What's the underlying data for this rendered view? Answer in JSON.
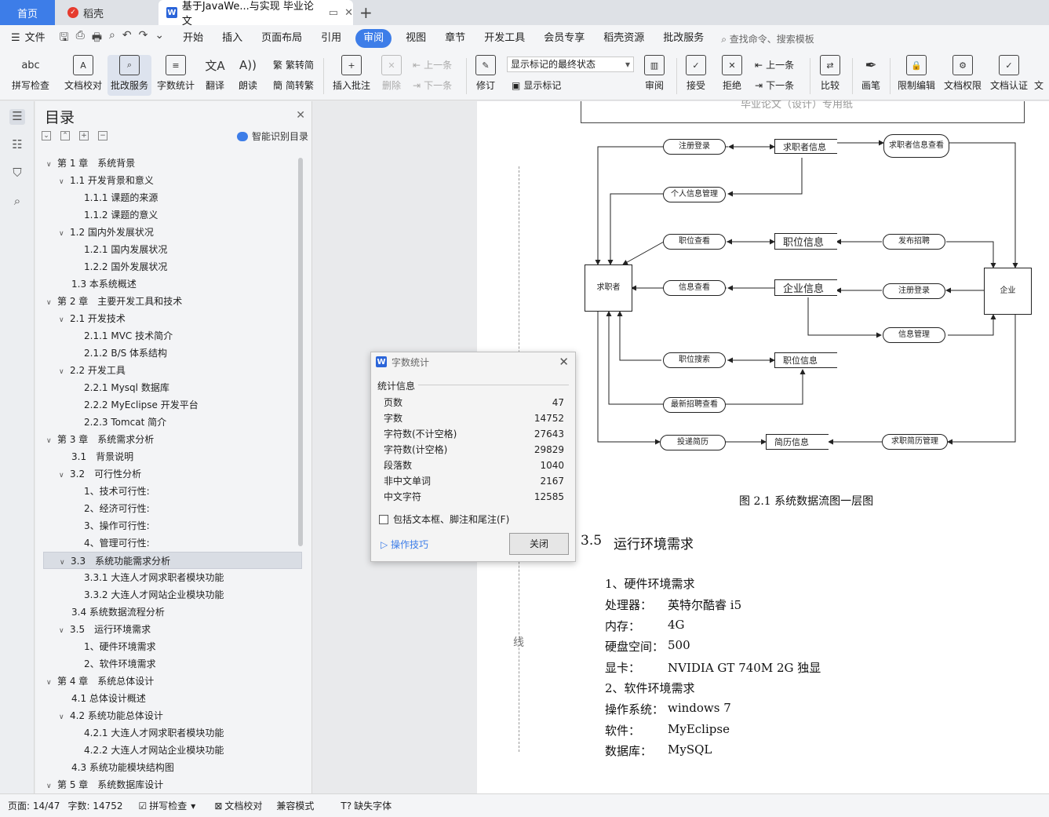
{
  "tabs": {
    "home": "首页",
    "daoke": "稻壳",
    "doc": "基于JavaWe...与实现 毕业论文"
  },
  "menu": {
    "file": "文件",
    "items": [
      "开始",
      "插入",
      "页面布局",
      "引用",
      "审阅",
      "视图",
      "章节",
      "开发工具",
      "会员专享",
      "稻壳资源",
      "批改服务"
    ],
    "active": "审阅",
    "search": "查找命令、搜索模板"
  },
  "ribbon": {
    "spell": "拼写检查",
    "doc_check": "文档校对",
    "correct": "批改服务",
    "word_count": "字数统计",
    "translate": "翻译",
    "read": "朗读",
    "to_trad": "繁转简",
    "to_simp": "简转繁",
    "insert_comment": "插入批注",
    "delete": "删除",
    "prev": "上一条",
    "next": "下一条",
    "revise": "修订",
    "markup_state": "显示标记的最终状态",
    "show_markup": "显示标记",
    "review": "审阅",
    "accept": "接受",
    "reject": "拒绝",
    "prev2": "上一条",
    "next2": "下一条",
    "compare": "比较",
    "pen": "画笔",
    "restrict": "限制编辑",
    "perm": "文档权限",
    "auth": "文档认证",
    "more": "文"
  },
  "toc": {
    "title": "目录",
    "smart": "智能识别目录",
    "items": [
      {
        "t": "第 1 章　系统背景",
        "lvl": 0,
        "c": true
      },
      {
        "t": "1.1 开发背景和意义",
        "lvl": 1,
        "c": true
      },
      {
        "t": "1.1.1  课题的来源",
        "lvl": 2,
        "c": false
      },
      {
        "t": "1.1.2 课题的意义",
        "lvl": 2,
        "c": false
      },
      {
        "t": "1.2  国内外发展状况",
        "lvl": 1,
        "c": true
      },
      {
        "t": "1.2.1  国内发展状况",
        "lvl": 2,
        "c": false
      },
      {
        "t": "1.2.2  国外发展状况",
        "lvl": 2,
        "c": false
      },
      {
        "t": "1.3 本系统概述",
        "lvl": 1,
        "c": false
      },
      {
        "t": "第 2 章　主要开发工具和技术",
        "lvl": 0,
        "c": true
      },
      {
        "t": "2.1  开发技术",
        "lvl": 1,
        "c": true
      },
      {
        "t": "2.1.1 MVC 技术简介",
        "lvl": 2,
        "c": false
      },
      {
        "t": "2.1.2 B/S 体系结构",
        "lvl": 2,
        "c": false
      },
      {
        "t": "2.2  开发工具",
        "lvl": 1,
        "c": true
      },
      {
        "t": "2.2.1 Mysql 数据库",
        "lvl": 2,
        "c": false
      },
      {
        "t": "2.2.2 MyEclipse 开发平台",
        "lvl": 2,
        "c": false
      },
      {
        "t": "2.2.3 Tomcat  简介",
        "lvl": 2,
        "c": false
      },
      {
        "t": "第 3 章　系统需求分析",
        "lvl": 0,
        "c": true
      },
      {
        "t": "3.1　背景说明",
        "lvl": 1,
        "c": false
      },
      {
        "t": "3.2　可行性分析",
        "lvl": 1,
        "c": true
      },
      {
        "t": "1、技术可行性:",
        "lvl": 2,
        "c": false
      },
      {
        "t": "2、经济可行性:",
        "lvl": 2,
        "c": false
      },
      {
        "t": "3、操作可行性:",
        "lvl": 2,
        "c": false
      },
      {
        "t": "4、管理可行性:",
        "lvl": 2,
        "c": false
      },
      {
        "t": "3.3　系统功能需求分析",
        "lvl": 1,
        "c": true,
        "sel": true
      },
      {
        "t": "3.3.1 大连人才网求职者模块功能",
        "lvl": 2,
        "c": false
      },
      {
        "t": "3.3.2 大连人才网站企业模块功能",
        "lvl": 2,
        "c": false
      },
      {
        "t": "3.4 系统数据流程分析",
        "lvl": 1,
        "c": false
      },
      {
        "t": "3.5　运行环境需求",
        "lvl": 1,
        "c": true
      },
      {
        "t": "1、硬件环境需求",
        "lvl": 2,
        "c": false
      },
      {
        "t": "2、软件环境需求",
        "lvl": 2,
        "c": false
      },
      {
        "t": "第 4 章　系统总体设计",
        "lvl": 0,
        "c": true
      },
      {
        "t": "4.1 总体设计概述",
        "lvl": 1,
        "c": false
      },
      {
        "t": "4.2 系统功能总体设计",
        "lvl": 1,
        "c": true
      },
      {
        "t": "4.2.1 大连人才网求职者模块功能",
        "lvl": 2,
        "c": false
      },
      {
        "t": "4.2.2 大连人才网站企业模块功能",
        "lvl": 2,
        "c": false
      },
      {
        "t": "4.3 系统功能模块结构图",
        "lvl": 1,
        "c": false
      },
      {
        "t": "第 5 章　系统数据库设计",
        "lvl": 0,
        "c": true
      }
    ]
  },
  "dialog": {
    "title": "字数统计",
    "section": "统计信息",
    "stats": [
      {
        "label": "页数",
        "value": "47"
      },
      {
        "label": "字数",
        "value": "14752"
      },
      {
        "label": "字符数(不计空格)",
        "value": "27643"
      },
      {
        "label": "字符数(计空格)",
        "value": "29829"
      },
      {
        "label": "段落数",
        "value": "1040"
      },
      {
        "label": "非中文单词",
        "value": "2167"
      },
      {
        "label": "中文字符",
        "value": "12585"
      }
    ],
    "include": "包括文本框、脚注和尾注(F)",
    "tips": "操作技巧",
    "close": "关闭"
  },
  "doc": {
    "header": "毕业论文（设计）专用纸",
    "margin_char": "线",
    "diagram": {
      "zcdl": "注册登录",
      "qzzxx": "求职者信息",
      "qzzxxck": "求职者信息查看",
      "grxxgl": "个人信息管理",
      "zwck": "职位查看",
      "zwxx": "职位信息",
      "fbzp": "发布招聘",
      "qzz": "求职者",
      "xxck": "信息查看",
      "qyxx": "企业信息",
      "zcdl2": "注册登录",
      "qy": "企业",
      "xxgl": "信息管理",
      "zwss": "职位搜索",
      "zwxx2": "职位信息",
      "zxzpck": "最新招聘查看",
      "tdjl": "投递简历",
      "jlxx": "简历信息",
      "qzjlgl": "求职简历管理"
    },
    "caption": "图 2.1  系统数据流图一层图",
    "sec_num": "3.5",
    "sec_title": "运行环境需求",
    "hw_title": "1、硬件环境需求",
    "lines": [
      {
        "k": "处理器：",
        "v": "英特尔酷睿 i5"
      },
      {
        "k": "内存：",
        "v": "4G"
      },
      {
        "k": "硬盘空间：",
        "v": "500"
      },
      {
        "k": "显卡：",
        "v": "NVIDIA GT 740M 2G 独显"
      }
    ],
    "sw_title": "2、软件环境需求",
    "lines2": [
      {
        "k": "操作系统：",
        "v": "windows 7"
      },
      {
        "k": "软件：",
        "v": "MyEclipse"
      },
      {
        "k": "数据库：",
        "v": "MySQL"
      }
    ]
  },
  "status": {
    "page": "页面: 14/47",
    "words": "字数: 14752",
    "spell": "拼写检查",
    "check": "文档校对",
    "compat": "兼容模式",
    "missing_font": "缺失字体"
  }
}
